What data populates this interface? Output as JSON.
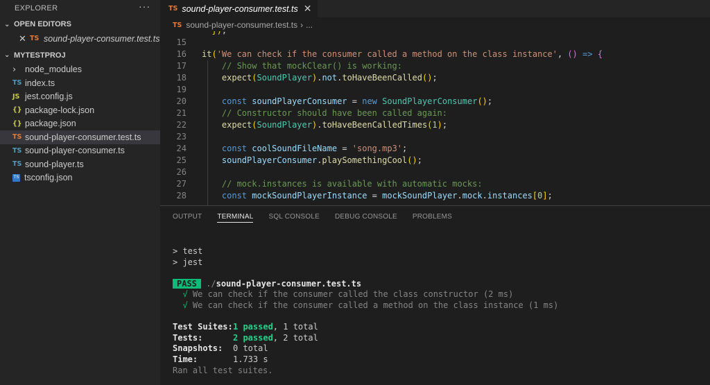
{
  "sidebar": {
    "title": "EXPLORER",
    "more": "···",
    "open_editors": {
      "label": "OPEN EDITORS",
      "items": [
        {
          "close": "✕",
          "icon": "TS",
          "name": "sound-player-consumer.test.ts"
        }
      ]
    },
    "project": {
      "label": "MYTESTPROJ",
      "items": [
        {
          "type": "folder",
          "icon": "›",
          "name": "node_modules"
        },
        {
          "type": "ts",
          "icon": "TS",
          "name": "index.ts"
        },
        {
          "type": "js",
          "icon": "JS",
          "name": "jest.config.js"
        },
        {
          "type": "json",
          "icon": "{}",
          "name": "package-lock.json"
        },
        {
          "type": "json",
          "icon": "{}",
          "name": "package.json"
        },
        {
          "type": "ts-test",
          "icon": "TS",
          "name": "sound-player-consumer.test.ts"
        },
        {
          "type": "ts",
          "icon": "TS",
          "name": "sound-player-consumer.ts"
        },
        {
          "type": "ts",
          "icon": "TS",
          "name": "sound-player.ts"
        },
        {
          "type": "tsconfig",
          "icon": "TS",
          "name": "tsconfig.json"
        }
      ]
    }
  },
  "editor": {
    "tab": {
      "icon": "TS",
      "label": "sound-player-consumer.test.ts",
      "close": "✕"
    },
    "breadcrumb": {
      "icon": "TS",
      "file": "sound-player-consumer.test.ts",
      "sep": "›",
      "rest": "..."
    },
    "lines": [
      {
        "n": "",
        "text": "  });"
      },
      {
        "n": "15",
        "text": ""
      },
      {
        "n": "16",
        "text": "it('We can check if the consumer called a method on the class instance', () => {"
      },
      {
        "n": "17",
        "text": "    // Show that mockClear() is working:"
      },
      {
        "n": "18",
        "text": "    expect(SoundPlayer).not.toHaveBeenCalled();"
      },
      {
        "n": "19",
        "text": ""
      },
      {
        "n": "20",
        "text": "    const soundPlayerConsumer = new SoundPlayerConsumer();"
      },
      {
        "n": "21",
        "text": "    // Constructor should have been called again:"
      },
      {
        "n": "22",
        "text": "    expect(SoundPlayer).toHaveBeenCalledTimes(1);"
      },
      {
        "n": "23",
        "text": ""
      },
      {
        "n": "24",
        "text": "    const coolSoundFileName = 'song.mp3';"
      },
      {
        "n": "25",
        "text": "    soundPlayerConsumer.playSomethingCool();"
      },
      {
        "n": "26",
        "text": ""
      },
      {
        "n": "27",
        "text": "    // mock.instances is available with automatic mocks:"
      },
      {
        "n": "28",
        "text": "    const mockSoundPlayerInstance = mockSoundPlayer.mock.instances[0];"
      }
    ]
  },
  "panel": {
    "tabs": [
      "OUTPUT",
      "TERMINAL",
      "SQL CONSOLE",
      "DEBUG CONSOLE",
      "PROBLEMS"
    ],
    "active_tab": "TERMINAL",
    "terminal": {
      "prompt1": "> test",
      "prompt2": "> jest",
      "pass": "PASS",
      "file_dir": "./",
      "file_name": "sound-player-consumer.test.ts",
      "tests": [
        {
          "check": "√",
          "text": "We can check if the consumer called the class constructor (2 ms)"
        },
        {
          "check": "√",
          "text": "We can check if the consumer called a method on the class instance (1 ms)"
        }
      ],
      "summary": [
        {
          "label": "Test Suites:",
          "passed": "1 passed",
          "rest": ", 1 total"
        },
        {
          "label": "Tests:",
          "passed": "2 passed",
          "rest": ", 2 total"
        },
        {
          "label": "Snapshots:",
          "passed": "",
          "rest": "0 total"
        },
        {
          "label": "Time:",
          "passed": "",
          "rest": "1.733 s"
        }
      ],
      "footer": "Ran all test suites."
    }
  },
  "colors": {
    "accent_pass": "#0dbc79",
    "ts_icon": "#519aba",
    "test_icon": "#e37933",
    "json_icon": "#cbcb41"
  }
}
